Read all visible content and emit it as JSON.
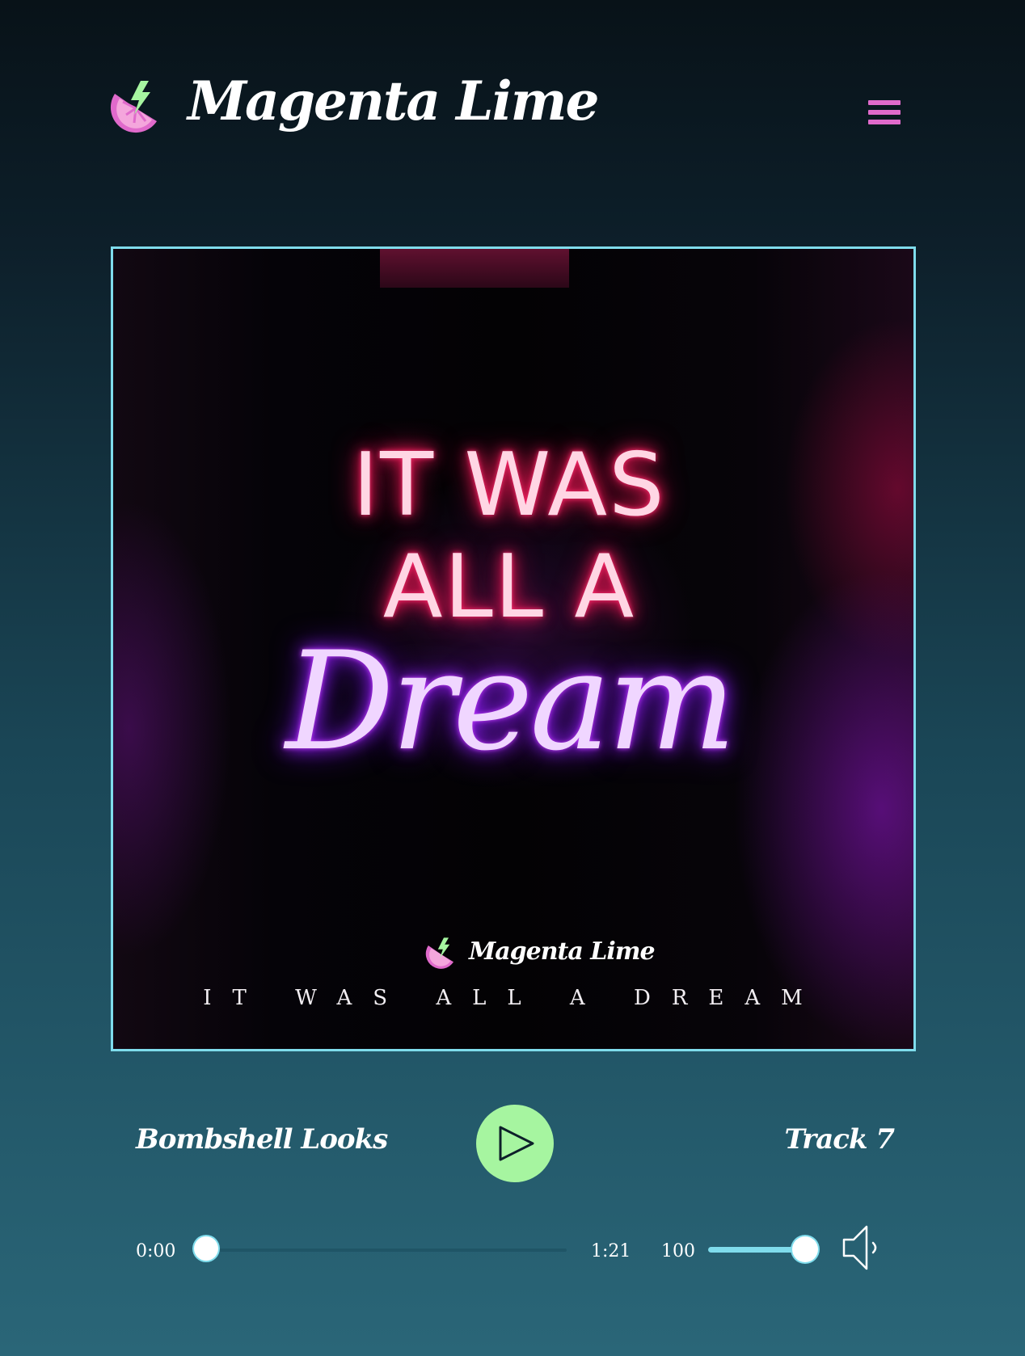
{
  "header": {
    "brand_name": "Magenta Lime",
    "logo_icon": "lime-slice-lightning-icon",
    "menu_icon": "hamburger-menu-icon"
  },
  "album": {
    "neon_line1": "IT WAS",
    "neon_line2": "ALL A",
    "neon_line3": "Dream",
    "brand_name": "Magenta Lime",
    "caption": "IT WAS ALL A DREAM"
  },
  "player": {
    "track_title": "Bombshell Looks",
    "track_number": "Track 7",
    "play_icon": "play-icon",
    "current_time": "0:00",
    "duration": "1:21",
    "progress": 0.0,
    "volume": "100",
    "volume_level": 1.0,
    "speaker_icon": "speaker-icon"
  },
  "colors": {
    "accent_magenta": "#e06acb",
    "accent_cyan": "#7fdcec",
    "accent_lime": "#a6f5a0",
    "background_top": "#081218",
    "background_bottom": "#2a6678"
  }
}
